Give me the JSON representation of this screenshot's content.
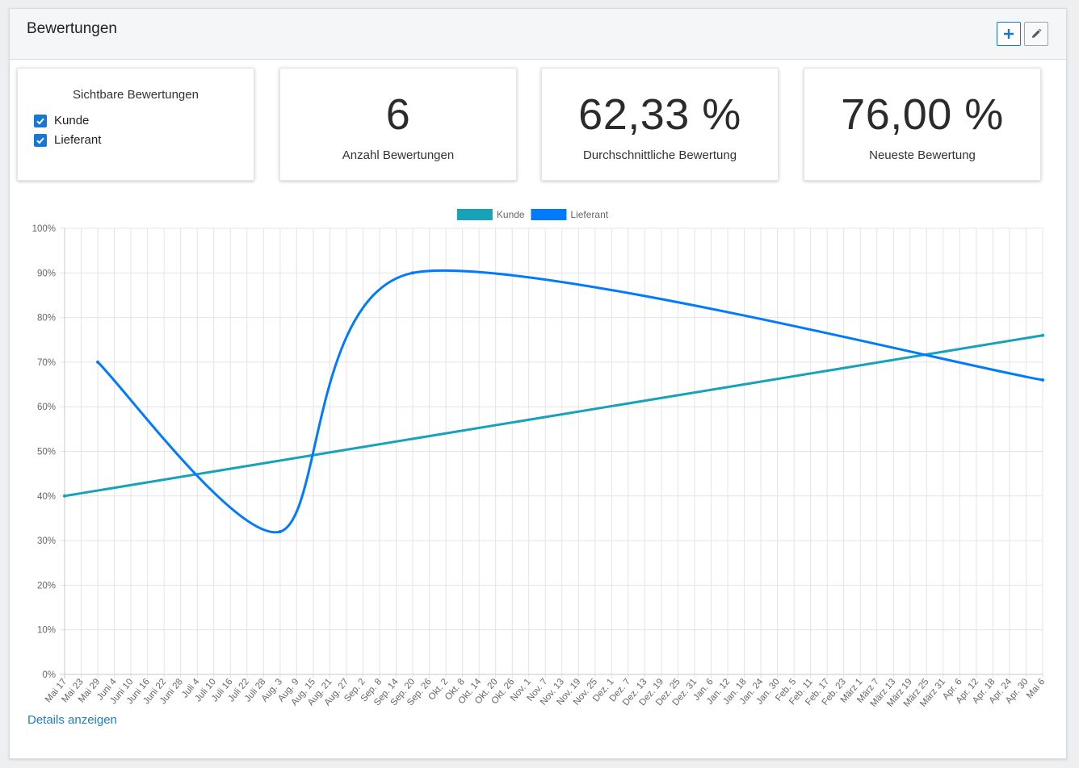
{
  "header": {
    "title": "Bewertungen",
    "add_icon": "plus-icon",
    "edit_icon": "pencil-icon"
  },
  "visible_ratings": {
    "title": "Sichtbare Bewertungen",
    "options": [
      {
        "label": "Kunde",
        "checked": true
      },
      {
        "label": "Lieferant",
        "checked": true
      }
    ]
  },
  "stats": [
    {
      "value": "6",
      "label": "Anzahl Bewertungen"
    },
    {
      "value": "62,33 %",
      "label": "Durchschnittliche Bewertung"
    },
    {
      "value": "76,00 %",
      "label": "Neueste Bewertung"
    }
  ],
  "colors": {
    "kunde": "#17a2b8",
    "lieferant": "#007bff",
    "accent": "#1976d2",
    "link": "#1a7fc9"
  },
  "chart_data": {
    "type": "line",
    "y_ticks": [
      "0%",
      "10%",
      "20%",
      "30%",
      "40%",
      "50%",
      "60%",
      "70%",
      "80%",
      "90%",
      "100%"
    ],
    "ylim": [
      0,
      100
    ],
    "categories": [
      "Mai 17",
      "Mai 23",
      "Mai 29",
      "Juni 4",
      "Juni 10",
      "Juni 16",
      "Juni 22",
      "Juni 28",
      "Juli 4",
      "Juli 10",
      "Juli 16",
      "Juli 22",
      "Juli 28",
      "Aug. 3",
      "Aug. 9",
      "Aug. 15",
      "Aug. 21",
      "Aug. 27",
      "Sep. 2",
      "Sep. 8",
      "Sep. 14",
      "Sep. 20",
      "Sep. 26",
      "Okt. 2",
      "Okt. 8",
      "Okt. 14",
      "Okt. 20",
      "Okt. 26",
      "Nov. 1",
      "Nov. 7",
      "Nov. 13",
      "Nov. 19",
      "Nov. 25",
      "Dez. 1",
      "Dez. 7",
      "Dez. 13",
      "Dez. 19",
      "Dez. 25",
      "Dez. 31",
      "Jan. 6",
      "Jan. 12",
      "Jan. 18",
      "Jan. 24",
      "Jan. 30",
      "Feb. 5",
      "Feb. 11",
      "Feb. 17",
      "Feb. 23",
      "März 1",
      "März 7",
      "März 13",
      "März 19",
      "März 25",
      "März 31",
      "Apr. 6",
      "Apr. 12",
      "Apr. 18",
      "Apr. 24",
      "Apr. 30",
      "Mai 6"
    ],
    "grid": true,
    "legend": "top-center",
    "series": [
      {
        "name": "Kunde",
        "color": "#17a2b8",
        "points": [
          {
            "x": "Mai 17",
            "y": 40
          },
          {
            "x": "Mai 6",
            "y": 76
          }
        ]
      },
      {
        "name": "Lieferant",
        "color": "#007bff",
        "points": [
          {
            "x": "Mai 29",
            "y": 70
          },
          {
            "x": "Aug. 3",
            "y": 32
          },
          {
            "x": "Sep. 20",
            "y": 90
          },
          {
            "x": "Mai 6",
            "y": 66
          }
        ]
      }
    ]
  },
  "footer": {
    "details_label": "Details anzeigen"
  }
}
